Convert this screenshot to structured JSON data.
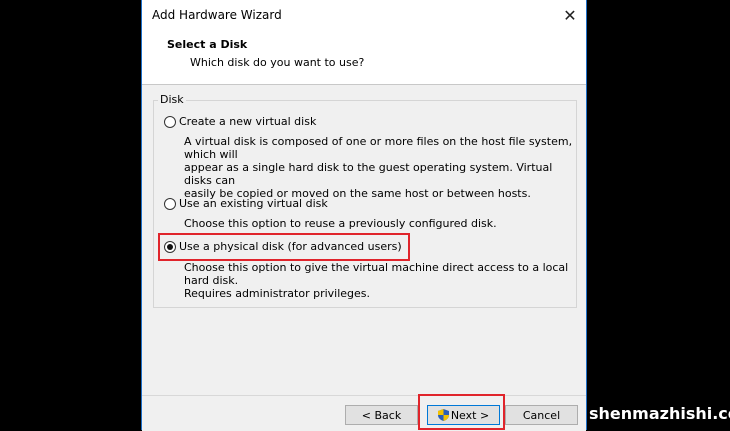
{
  "window": {
    "title": "Add Hardware Wizard"
  },
  "header": {
    "title": "Select a Disk",
    "subtitle": "Which disk do you want to use?"
  },
  "group": {
    "label": "Disk",
    "options": [
      {
        "label": "Create a new virtual disk",
        "selected": false,
        "description_lines": [
          "A virtual disk is composed of one or more files on the host file system, which will",
          "appear as a single hard disk to the guest operating system. Virtual disks can",
          "easily be copied or moved on the same host or between hosts."
        ]
      },
      {
        "label": "Use an existing virtual disk",
        "selected": false,
        "description_lines": [
          "Choose this option to reuse a previously configured disk."
        ]
      },
      {
        "label": "Use a physical disk (for advanced users)",
        "selected": true,
        "description_lines": [
          "Choose this option to give the virtual machine direct access to a local hard disk.",
          "Requires administrator privileges."
        ]
      }
    ]
  },
  "footer": {
    "back_label": "< Back",
    "next_label": "Next >",
    "cancel_label": "Cancel"
  },
  "watermark": "shenmazhishi.com",
  "colors": {
    "highlight": "#e0242b",
    "accent": "#0078d7"
  }
}
